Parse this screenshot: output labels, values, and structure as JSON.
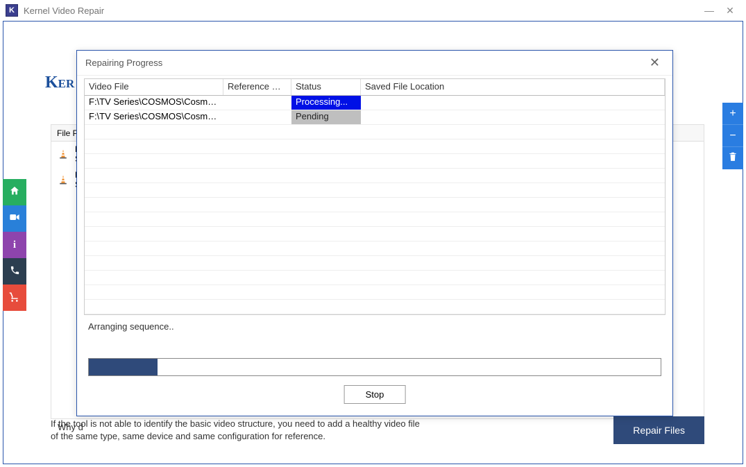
{
  "window": {
    "title": "Kernel Video Repair",
    "app_icon_letter": "K"
  },
  "logo_text": "Ker",
  "files_header": "File P",
  "files": [
    {
      "line1": "F:\\",
      "line2": "Se"
    },
    {
      "line1": "F:\\",
      "line2": "Se"
    }
  ],
  "hint_prefix": "Why d",
  "hint_full": "If the tool is not able to identify the basic video structure, you need to add a healthy video file of the same type, same device and same configuration for reference.",
  "repair_btn": "Repair Files",
  "modal": {
    "title": "Repairing Progress",
    "columns": {
      "video_file": "Video File",
      "ref": "Reference Vi...",
      "status": "Status",
      "saved": "Saved File Location"
    },
    "rows": [
      {
        "video_file": "F:\\TV Series\\COSMOS\\Cosmos...",
        "ref": "",
        "status": "Processing...",
        "status_class": "st-processing",
        "saved": ""
      },
      {
        "video_file": "F:\\TV Series\\COSMOS\\Cosmos...",
        "ref": "",
        "status": "Pending",
        "status_class": "st-pending",
        "saved": ""
      }
    ],
    "status_text": "Arranging sequence..",
    "progress_percent": 12,
    "stop_label": "Stop"
  },
  "icons": {
    "minimize": "—",
    "close": "✕",
    "home": "home-icon",
    "video": "video-icon",
    "info": "i",
    "phone": "phone-icon",
    "cart": "cart-icon",
    "plus": "+",
    "minus": "−",
    "trash": "trash-icon"
  }
}
